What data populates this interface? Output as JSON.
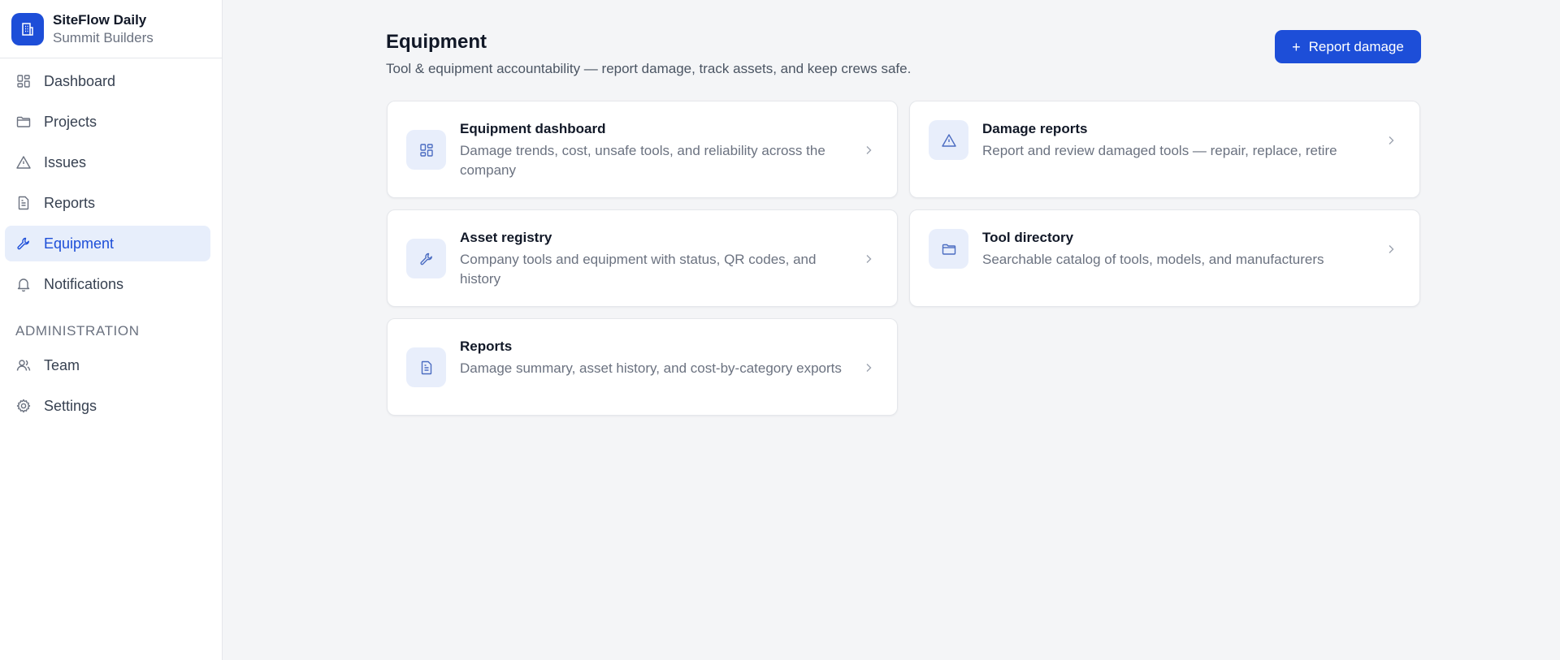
{
  "brand": {
    "name": "SiteFlow Daily",
    "org": "Summit Builders"
  },
  "sidebar": {
    "items": [
      {
        "label": "Dashboard",
        "icon": "grid-icon"
      },
      {
        "label": "Projects",
        "icon": "folder-icon"
      },
      {
        "label": "Issues",
        "icon": "warning-icon"
      },
      {
        "label": "Reports",
        "icon": "document-icon"
      },
      {
        "label": "Equipment",
        "icon": "wrench-icon",
        "active": true
      },
      {
        "label": "Notifications",
        "icon": "bell-icon"
      }
    ],
    "admin_label": "ADMINISTRATION",
    "admin_items": [
      {
        "label": "Team",
        "icon": "users-icon"
      },
      {
        "label": "Settings",
        "icon": "gear-icon"
      }
    ]
  },
  "header": {
    "title": "Equipment",
    "subtitle": "Tool & equipment accountability — report damage, track assets, and keep crews safe.",
    "action_label": "Report damage",
    "action_icon": "plus-icon"
  },
  "cards": [
    {
      "title": "Equipment dashboard",
      "description": "Damage trends, cost, unsafe tools, and reliability across the company",
      "icon": "grid-icon"
    },
    {
      "title": "Damage reports",
      "description": "Report and review damaged tools — repair, replace, retire",
      "icon": "warning-icon"
    },
    {
      "title": "Asset registry",
      "description": "Company tools and equipment with status, QR codes, and history",
      "icon": "wrench-icon"
    },
    {
      "title": "Tool directory",
      "description": "Searchable catalog of tools, models, and manufacturers",
      "icon": "folder-icon"
    },
    {
      "title": "Reports",
      "description": "Damage summary, asset history, and cost-by-category exports",
      "icon": "document-icon"
    }
  ],
  "colors": {
    "accent": "#1d4ed8",
    "active_bg": "#e7eefb",
    "icon_tile_bg": "#e8eefb",
    "icon_stroke": "#6b7280",
    "card_icon_stroke": "#4b6cc1"
  }
}
